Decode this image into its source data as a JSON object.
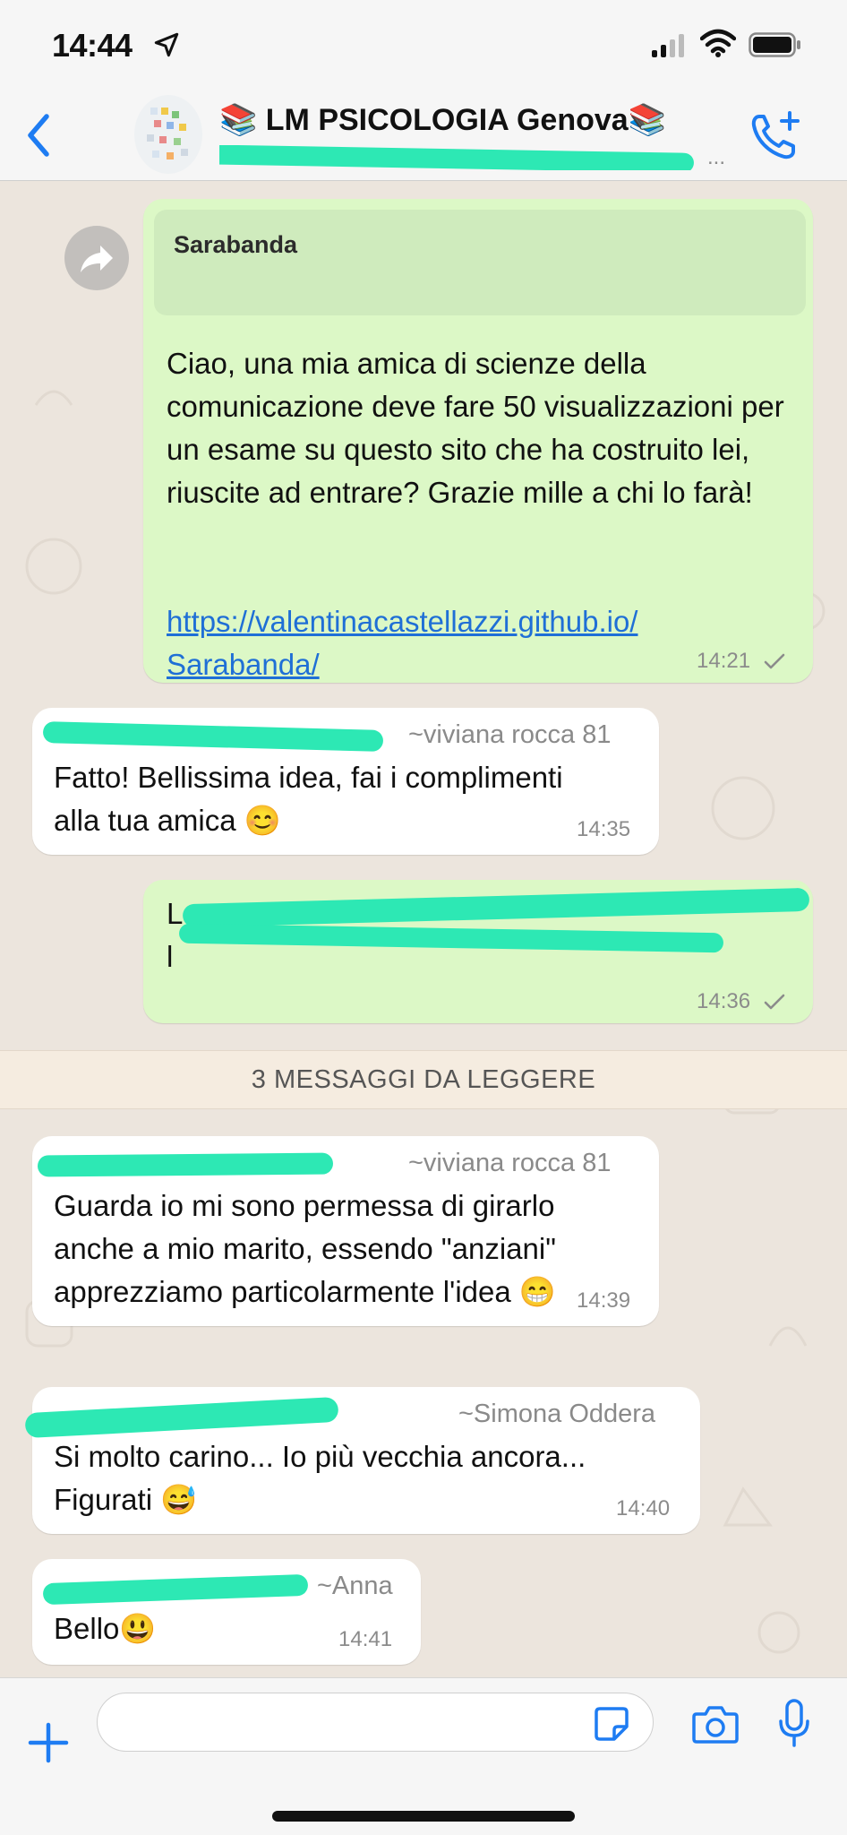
{
  "status_bar": {
    "time": "14:44",
    "icons": [
      "location-arrow-icon",
      "signal-icon",
      "wifi-icon",
      "battery-icon"
    ]
  },
  "header": {
    "back_icon": "chevron-left-icon",
    "title": "📚 LM PSICOLOGIA Genova📚",
    "subtitle": "...",
    "call_icon": "add-call-icon"
  },
  "colors": {
    "accent": "#1e7cf2",
    "outgoing_bubble": "#dcf8c6",
    "incoming_bubble": "#ffffff",
    "background": "#ece5dd",
    "redaction": "#2de8b4"
  },
  "messages": [
    {
      "direction": "out",
      "forwarded_icon": "forward-icon",
      "quote_author": "Sarabanda",
      "text": "Ciao, una mia amica di scienze della comunicazione deve fare 50 visualizzazioni per un esame su questo sito che ha costruito lei, riuscite ad entrare? Grazie mille a chi lo farà!",
      "link": "https://valentinacastellazzi.github.io/Sarabanda/",
      "link_line1": "https://valentinacastellazzi.github.io/",
      "link_line2": "Sarabanda/",
      "time": "14:21",
      "status": "sent"
    },
    {
      "direction": "in",
      "sender": "~viviana rocca 81",
      "text_line1": "Fatto! Bellissima idea, fai i complimenti",
      "text_line2": "alla tua amica 😊",
      "time": "14:35"
    },
    {
      "direction": "out",
      "text_line1": "L",
      "text_line2": "l",
      "text_redacted": true,
      "time": "14:36",
      "status": "sent"
    },
    {
      "direction": "in",
      "sender": "~viviana rocca 81",
      "text_line1": "Guarda io mi sono permessa di girarlo",
      "text_line2": "anche a mio marito, essendo \"anziani\"",
      "text_line3": "apprezziamo particolarmente l'idea 😁",
      "time": "14:39"
    },
    {
      "direction": "in",
      "sender": "~Simona Oddera",
      "text_line1": "Si molto carino... Io più vecchia ancora...",
      "text_line2": "Figurati 😅",
      "time": "14:40"
    },
    {
      "direction": "in",
      "sender": "~Anna",
      "text_line1": "Bello😃",
      "time": "14:41"
    }
  ],
  "unread_banner": "3 MESSAGGI DA LEGGERE",
  "input_bar": {
    "placeholder": "",
    "icons": [
      "plus-icon",
      "sticker-icon",
      "camera-icon",
      "microphone-icon"
    ]
  }
}
